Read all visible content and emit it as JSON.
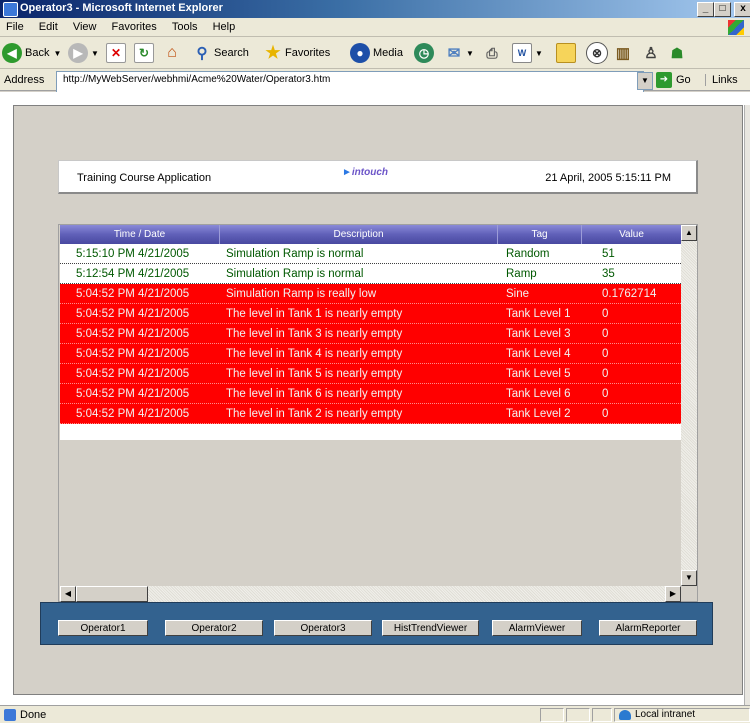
{
  "window": {
    "title": "Operator3 - Microsoft Internet Explorer",
    "min_glyph": "_",
    "max_glyph": "□",
    "close_glyph": "x"
  },
  "menu": [
    "File",
    "Edit",
    "View",
    "Favorites",
    "Tools",
    "Help"
  ],
  "toolbar": {
    "back_label": "Back",
    "search_label": "Search",
    "favorites_label": "Favorites",
    "media_label": "Media"
  },
  "address": {
    "label": "Address",
    "url": "http://MyWebServer/webhmi/Acme%20Water/Operator3.htm",
    "go_label": "Go",
    "links_label": "Links"
  },
  "header": {
    "left_text": "Training Course Application",
    "logo_text": "intouch",
    "datetime": "21 April, 2005 5:15:11 PM"
  },
  "grid": {
    "columns": [
      "Time / Date",
      "Description",
      "Tag",
      "Value"
    ],
    "rows": [
      {
        "time": "5:15:10 PM  4/21/2005",
        "desc": "Simulation Ramp is normal",
        "tag": "Random",
        "value": "51",
        "state": "normal"
      },
      {
        "time": "5:12:54 PM  4/21/2005",
        "desc": "Simulation Ramp is normal",
        "tag": "Ramp",
        "value": "35",
        "state": "normal"
      },
      {
        "time": "5:04:52 PM  4/21/2005",
        "desc": "Simulation Ramp is really low",
        "tag": "Sine",
        "value": "0.1762714",
        "state": "alarm"
      },
      {
        "time": "5:04:52 PM  4/21/2005",
        "desc": "The level in Tank 1 is nearly empty",
        "tag": "Tank Level 1",
        "value": "0",
        "state": "alarm"
      },
      {
        "time": "5:04:52 PM  4/21/2005",
        "desc": "The level in Tank 3 is nearly empty",
        "tag": "Tank Level 3",
        "value": "0",
        "state": "alarm"
      },
      {
        "time": "5:04:52 PM  4/21/2005",
        "desc": "The level in Tank 4 is nearly empty",
        "tag": "Tank Level 4",
        "value": "0",
        "state": "alarm"
      },
      {
        "time": "5:04:52 PM  4/21/2005",
        "desc": "The level in Tank 5 is nearly empty",
        "tag": "Tank Level 5",
        "value": "0",
        "state": "alarm"
      },
      {
        "time": "5:04:52 PM  4/21/2005",
        "desc": "The level in Tank 6 is nearly empty",
        "tag": "Tank Level 6",
        "value": "0",
        "state": "alarm"
      },
      {
        "time": "5:04:52 PM  4/21/2005",
        "desc": "The level in Tank 2 is nearly empty",
        "tag": "Tank Level 2",
        "value": "0",
        "state": "alarm"
      }
    ]
  },
  "nav_buttons": [
    "Operator1",
    "Operator2",
    "Operator3",
    "HistTrendViewer",
    "AlarmViewer",
    "AlarmReporter"
  ],
  "status": {
    "text": "Done",
    "zone": "Local intranet"
  },
  "colors": {
    "alarm_row": "#ff0000",
    "normal_text": "#005800",
    "header_blue": "#6060b8",
    "nav_panel": "#33628f"
  }
}
